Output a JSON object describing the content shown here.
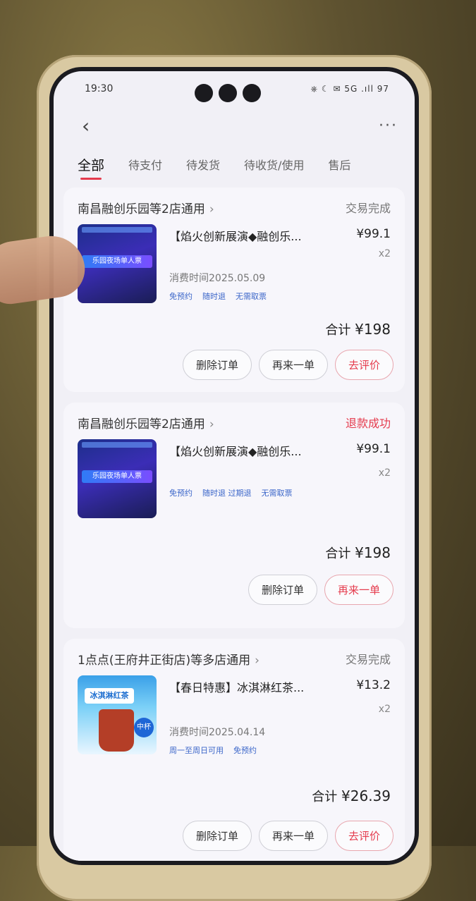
{
  "status_bar": {
    "time": "19:30",
    "icons": "⎈ ☾ ✉ 5G .ıll 97"
  },
  "nav": {
    "back_icon": "‹",
    "more_icon": "···"
  },
  "tabs": [
    "全部",
    "待支付",
    "待发货",
    "待收货/使用",
    "售后"
  ],
  "orders": [
    {
      "store": "南昌融创乐园等2店通用",
      "status": "交易完成",
      "thumb_banner": "乐园夜场单人票",
      "title": "【焰火创新展演◆融创乐...",
      "price": "¥99.1",
      "qty": "x2",
      "consume_time": "消费时间2025.05.09",
      "tags": [
        "免预约",
        "随时退",
        "无需取票"
      ],
      "total_label": "合计",
      "total": "¥198",
      "buttons": [
        "删除订单",
        "再来一单",
        "去评价"
      ]
    },
    {
      "store": "南昌融创乐园等2店通用",
      "status": "退款成功",
      "thumb_banner": "乐园夜场单人票",
      "title": "【焰火创新展演◆融创乐...",
      "price": "¥99.1",
      "qty": "x2",
      "tags": [
        "免预约",
        "随时退 过期退",
        "无需取票"
      ],
      "total_label": "合计",
      "total": "¥198",
      "buttons": [
        "删除订单",
        "再来一单"
      ]
    },
    {
      "store": "1点点(王府井正街店)等多店通用",
      "status": "交易完成",
      "thumb_label": "冰淇淋红茶",
      "thumb_badge": "中杯",
      "title": "【春日特惠】冰淇淋红茶...",
      "price": "¥13.2",
      "qty": "x2",
      "consume_time": "消费时间2025.04.14",
      "tags": [
        "周一至周日可用",
        "免预约"
      ],
      "total_label": "合计",
      "total": "¥26.39",
      "buttons": [
        "删除订单",
        "再来一单",
        "去评价"
      ]
    }
  ]
}
